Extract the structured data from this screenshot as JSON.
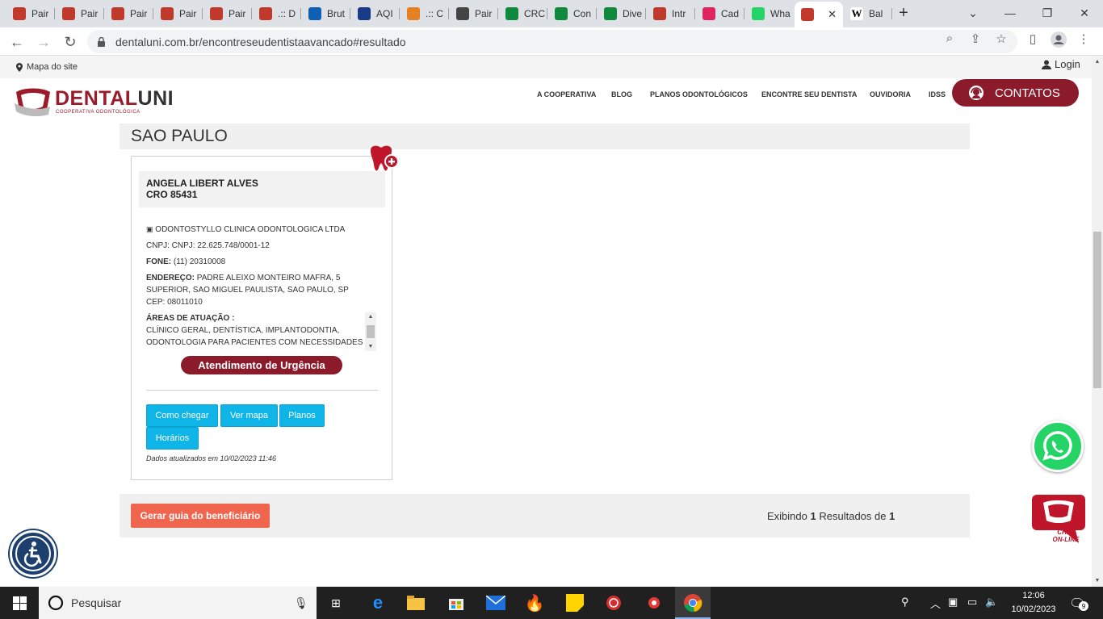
{
  "browser": {
    "tabs": [
      {
        "label": "Pair",
        "color": "#c0392b"
      },
      {
        "label": "Pair",
        "color": "#c0392b"
      },
      {
        "label": "Pair",
        "color": "#c0392b"
      },
      {
        "label": "Pair",
        "color": "#c0392b"
      },
      {
        "label": "Pair",
        "color": "#c0392b"
      },
      {
        "label": ".:: D",
        "color": "#c0392b"
      },
      {
        "label": "Brut",
        "color": "#0f5fb5"
      },
      {
        "label": "AQI",
        "color": "#1a3a8a"
      },
      {
        "label": ".:: C",
        "color": "#e67e22"
      },
      {
        "label": "Pair",
        "color": "#444444"
      },
      {
        "label": "CRC",
        "color": "#0f8a3c"
      },
      {
        "label": "Con",
        "color": "#0f8a3c"
      },
      {
        "label": "Dive",
        "color": "#0f8a3c"
      },
      {
        "label": "Intr",
        "color": "#c0392b"
      },
      {
        "label": "Cad",
        "color": "#e0245e"
      },
      {
        "label": "Wha",
        "color": "#25d366"
      },
      {
        "label": "",
        "color": "#c0392b"
      },
      {
        "label": "Bal",
        "color": "#ffffff"
      }
    ],
    "wiki_glyph": "W",
    "url": "dentaluni.com.br/encontreseudentistaavancado#resultado"
  },
  "site": {
    "sitemap_label": "Mapa do site",
    "login_label": "Login",
    "logo_dental": "DENTAL",
    "logo_uni": "UNI",
    "logo_sub": "COOPERATIVA ODONTOLÓGICA",
    "menu": [
      "A COOPERATIVA",
      "BLOG",
      "PLANOS ODONTOLÓGICOS",
      "ENCONTRE SEU DENTISTA",
      "OUVIDORIA",
      "IDSS"
    ],
    "contacts_label": "CONTATOS"
  },
  "result": {
    "city": "SAO PAULO",
    "dentist_name": "ANGELA LIBERT ALVES",
    "cro": "CRO 85431",
    "clinic": "ODONTOSTYLLO CLINICA ODONTOLOGICA LTDA",
    "cnpj": "CNPJ: CNPJ: 22.625.748/0001-12",
    "phone_label": "FONE:",
    "phone": "(11) 20310008",
    "address_label": "ENDEREÇO:",
    "address": "PADRE ALEIXO MONTEIRO MAFRA, 5 SUPERIOR, SAO MIGUEL PAULISTA, SAO PAULO, SP CEP: 08011010",
    "areas_label": "ÁREAS DE ATUAÇÃO :",
    "areas": "CLÍNICO GERAL, DENTÍSTICA, IMPLANTODONTIA, ODONTOLOGIA PARA PACIENTES COM NECESSIDADES ESPECIAIS",
    "urgent_label": "Atendimento de Urgência",
    "buttons": {
      "directions": "Como chegar",
      "map": "Ver mapa",
      "plans": "Planos",
      "hours": "Horários"
    },
    "updated": "Dados atualizados em 10/02/2023 11:46"
  },
  "footer": {
    "guide_button": "Gerar guia do beneficiário",
    "showing": "Exibindo",
    "count": "1",
    "results_of": "Resultados de",
    "total": "1"
  },
  "chat": {
    "line1": "CHAT",
    "line2": "ON-LINE"
  },
  "taskbar": {
    "search_placeholder": "Pesquisar",
    "time": "12:06",
    "date": "10/02/2023",
    "notifications": "9"
  },
  "colors": {
    "brand": "#8b1a2b",
    "cta": "#10b5e8",
    "guide": "#f0654e"
  }
}
